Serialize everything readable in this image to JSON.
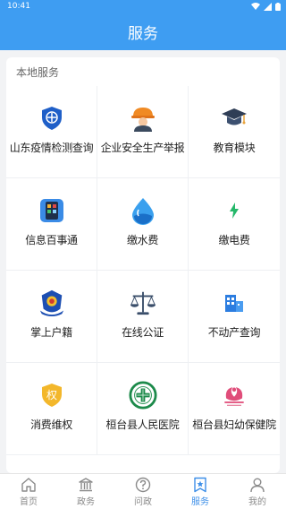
{
  "status": {
    "time": "10:41"
  },
  "header": {
    "title": "服务"
  },
  "section": {
    "title": "本地服务"
  },
  "services": [
    {
      "label": "山东疫情检测查询",
      "icon": "shield-cross-icon"
    },
    {
      "label": "企业安全生产举报",
      "icon": "worker-helmet-icon"
    },
    {
      "label": "教育模块",
      "icon": "graduation-cap-icon"
    },
    {
      "label": "信息百事通",
      "icon": "phone-apps-icon"
    },
    {
      "label": "缴水费",
      "icon": "water-drop-icon"
    },
    {
      "label": "缴电费",
      "icon": "lightning-icon"
    },
    {
      "label": "掌上户籍",
      "icon": "police-emblem-icon"
    },
    {
      "label": "在线公证",
      "icon": "scales-icon"
    },
    {
      "label": "不动产查询",
      "icon": "building-icon"
    },
    {
      "label": "消费维权",
      "icon": "consumer-shield-icon"
    },
    {
      "label": "桓台县人民医院",
      "icon": "hospital-emblem-icon"
    },
    {
      "label": "桓台县妇幼保健院",
      "icon": "maternal-hospital-icon"
    }
  ],
  "tabs": [
    {
      "label": "首页",
      "icon": "home-icon"
    },
    {
      "label": "政务",
      "icon": "government-icon"
    },
    {
      "label": "问政",
      "icon": "question-icon"
    },
    {
      "label": "服务",
      "icon": "bookmark-star-icon"
    },
    {
      "label": "我的",
      "icon": "user-icon"
    }
  ],
  "colors": {
    "primary": "#3e9df2",
    "tab_active": "#3e8fe8"
  }
}
